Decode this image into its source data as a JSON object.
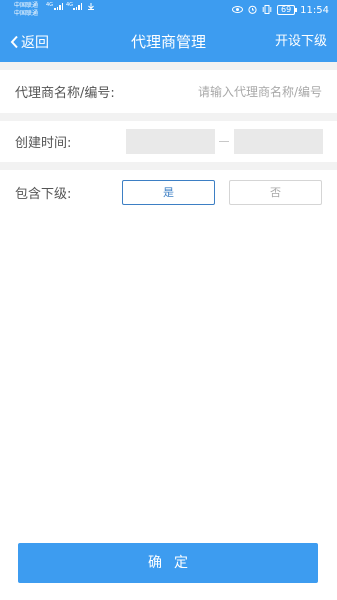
{
  "status_bar": {
    "carrier_1": "中国联通",
    "carrier_2": "中国联通",
    "net_1": "4G",
    "net_2": "4G",
    "battery": "69",
    "time": "11:54"
  },
  "navbar": {
    "back_label": "返回",
    "title": "代理商管理",
    "action_label": "开设下级"
  },
  "form": {
    "name_label": "代理商名称/编号:",
    "name_placeholder": "请输入代理商名称/编号",
    "created_label": "创建时间:",
    "range_separator": "-",
    "include_label": "包含下级:",
    "option_yes": "是",
    "option_no": "否",
    "include_selected": "是"
  },
  "confirm_label": "确定",
  "colors": {
    "brand_blue": "#3d9cf0",
    "selected_border": "#3d7fc4",
    "section_gap": "#f2f2f2"
  }
}
